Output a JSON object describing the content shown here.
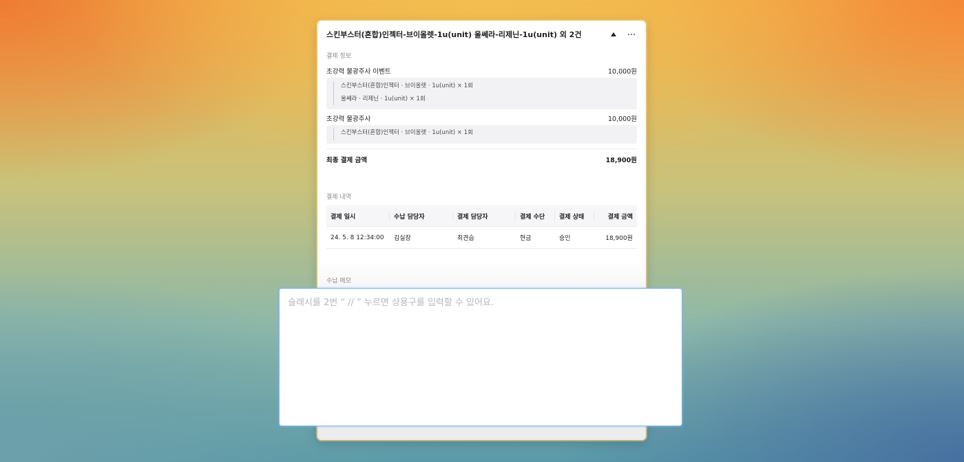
{
  "card": {
    "title": "스킨부스터(혼합)인젝터-브이올렛-1u(unit) 울쎄라-리제닌-1u(unit) 외 2건"
  },
  "payment_info": {
    "section_label": "결제 정보",
    "items": [
      {
        "name": "초강력 물광주사 이벤트",
        "amount": "10,000원",
        "details": [
          "스킨부스터(혼합)인젝터 · 브이올렛 · 1u(unit) × 1회",
          "울쎄라 · 리제닌 · 1u(unit) × 1회"
        ]
      },
      {
        "name": "초강력 물광주사",
        "amount": "10,000원",
        "details": [
          "스킨부스터(혼합)인젝터 · 브이올렛 · 1u(unit) × 1회"
        ]
      }
    ],
    "total_label": "최종 결제 금액",
    "total_amount": "18,900원"
  },
  "payment_history": {
    "section_label": "결제 내역",
    "columns": [
      "결제 일시",
      "수납 담당자",
      "결제 담당자",
      "결제 수단",
      "결제 상태",
      "결제 금액"
    ],
    "rows": [
      [
        "24. 5. 8 12:34:00",
        "김실장",
        "최견습",
        "현금",
        "승인",
        "18,900원"
      ]
    ]
  },
  "memo": {
    "section_label": "수납 메모",
    "placeholder": "슬래시를 2번 “ // ” 누르면 상용구를 입력할 수 있어요.",
    "value": ""
  },
  "icons": {
    "collapse": "caret-up-icon",
    "more": "more-horizontal-icon"
  },
  "colors": {
    "focus_border": "#7ab6f5"
  }
}
